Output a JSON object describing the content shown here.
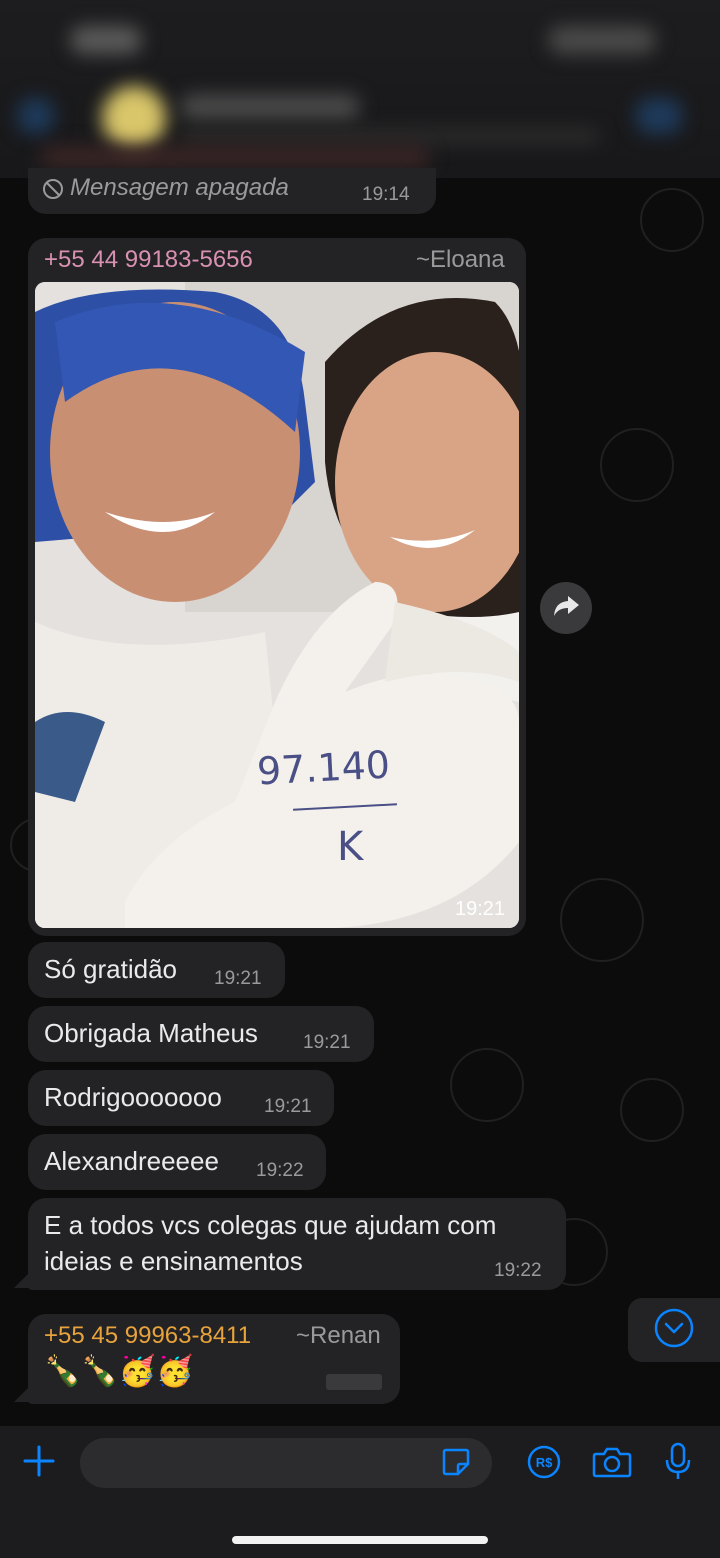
{
  "messages": {
    "deleted": {
      "text": "Mensagem apagada",
      "time": "19:14"
    },
    "photo": {
      "sender_phone": "+55 44 99183-5656",
      "sender_name": "~Eloana",
      "time": "19:21",
      "glove_text_top": "97.140",
      "glove_text_bottom": "K"
    },
    "texts": [
      {
        "text": "Só gratidão",
        "time": "19:21"
      },
      {
        "text": "Obrigada Matheus",
        "time": "19:21"
      },
      {
        "text": "Rodrigooooooo",
        "time": "19:21"
      },
      {
        "text": "Alexandreeeee",
        "time": "19:22"
      },
      {
        "line1": "E a todos vcs colegas que ajudam com",
        "line2": "ideias e ensinamentos",
        "time": "19:22"
      }
    ],
    "last": {
      "sender_phone": "+55 45 99963-8411",
      "sender_name": "~Renan",
      "emojis": "🍾🍾🥳🥳"
    }
  },
  "colors": {
    "accent_blue": "#0a84ff",
    "sender_pink": "#d991b2",
    "sender_orange": "#e8a33c",
    "bubble": "#232325"
  },
  "icons": {
    "deleted": "block-icon",
    "forward": "forward-icon",
    "scroll_down": "chevron-down-icon",
    "add": "plus-icon",
    "sticker": "sticker-icon",
    "payment": "payment-icon",
    "camera": "camera-icon",
    "mic": "microphone-icon"
  }
}
